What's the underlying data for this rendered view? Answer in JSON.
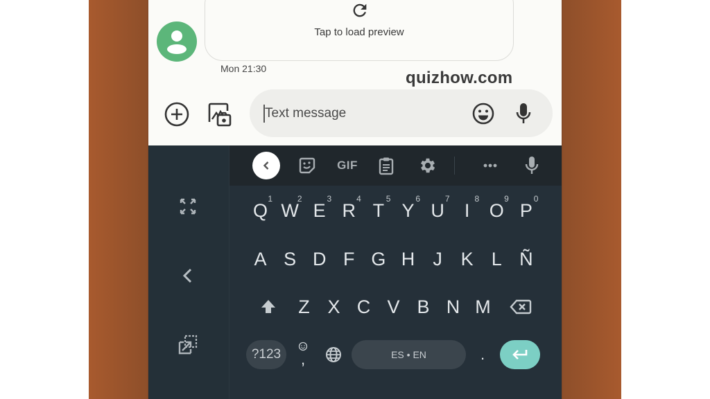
{
  "colors": {
    "frame_brown": "#8e4f2a",
    "screen_bg": "#fbfbf8",
    "avatar_green": "#5cb67a",
    "keyboard_bg": "#253039",
    "toolbar_bg": "#20272c",
    "enter_accent": "#7ccfc4"
  },
  "conversation": {
    "preview_text": "Tap to load preview",
    "timestamp": "Mon 21:30",
    "watermark": "quizhow.com"
  },
  "compose": {
    "placeholder": "Text message",
    "icons": [
      "add-icon",
      "gallery-camera-icon",
      "emoji-icon",
      "microphone-icon"
    ]
  },
  "keyboard": {
    "side_icons": [
      "expand-icon",
      "back-chevron-icon",
      "float-window-icon"
    ],
    "toolbar": {
      "items": [
        "collapse-chevron-icon",
        "sticker-icon",
        "gif",
        "clipboard-icon",
        "settings-gear-icon",
        "more-icon",
        "microphone-icon"
      ],
      "gif_label": "GIF"
    },
    "rows": [
      {
        "keys": [
          {
            "label": "Q",
            "hint": "1"
          },
          {
            "label": "W",
            "hint": "2"
          },
          {
            "label": "E",
            "hint": "3"
          },
          {
            "label": "R",
            "hint": "4"
          },
          {
            "label": "T",
            "hint": "5"
          },
          {
            "label": "Y",
            "hint": "6"
          },
          {
            "label": "U",
            "hint": "7"
          },
          {
            "label": "I",
            "hint": "8"
          },
          {
            "label": "O",
            "hint": "9"
          },
          {
            "label": "P",
            "hint": "0"
          }
        ]
      },
      {
        "keys": [
          {
            "label": "A"
          },
          {
            "label": "S"
          },
          {
            "label": "D"
          },
          {
            "label": "F"
          },
          {
            "label": "G"
          },
          {
            "label": "H"
          },
          {
            "label": "J"
          },
          {
            "label": "K"
          },
          {
            "label": "L"
          },
          {
            "label": "Ñ"
          }
        ]
      },
      {
        "keys": [
          {
            "label": "Z"
          },
          {
            "label": "X"
          },
          {
            "label": "C"
          },
          {
            "label": "V"
          },
          {
            "label": "B"
          },
          {
            "label": "N"
          },
          {
            "label": "M"
          }
        ]
      }
    ],
    "bottom": {
      "symbols_label": "?123",
      "comma_label": ",",
      "space_label": "ES • EN",
      "period_label": "."
    }
  }
}
